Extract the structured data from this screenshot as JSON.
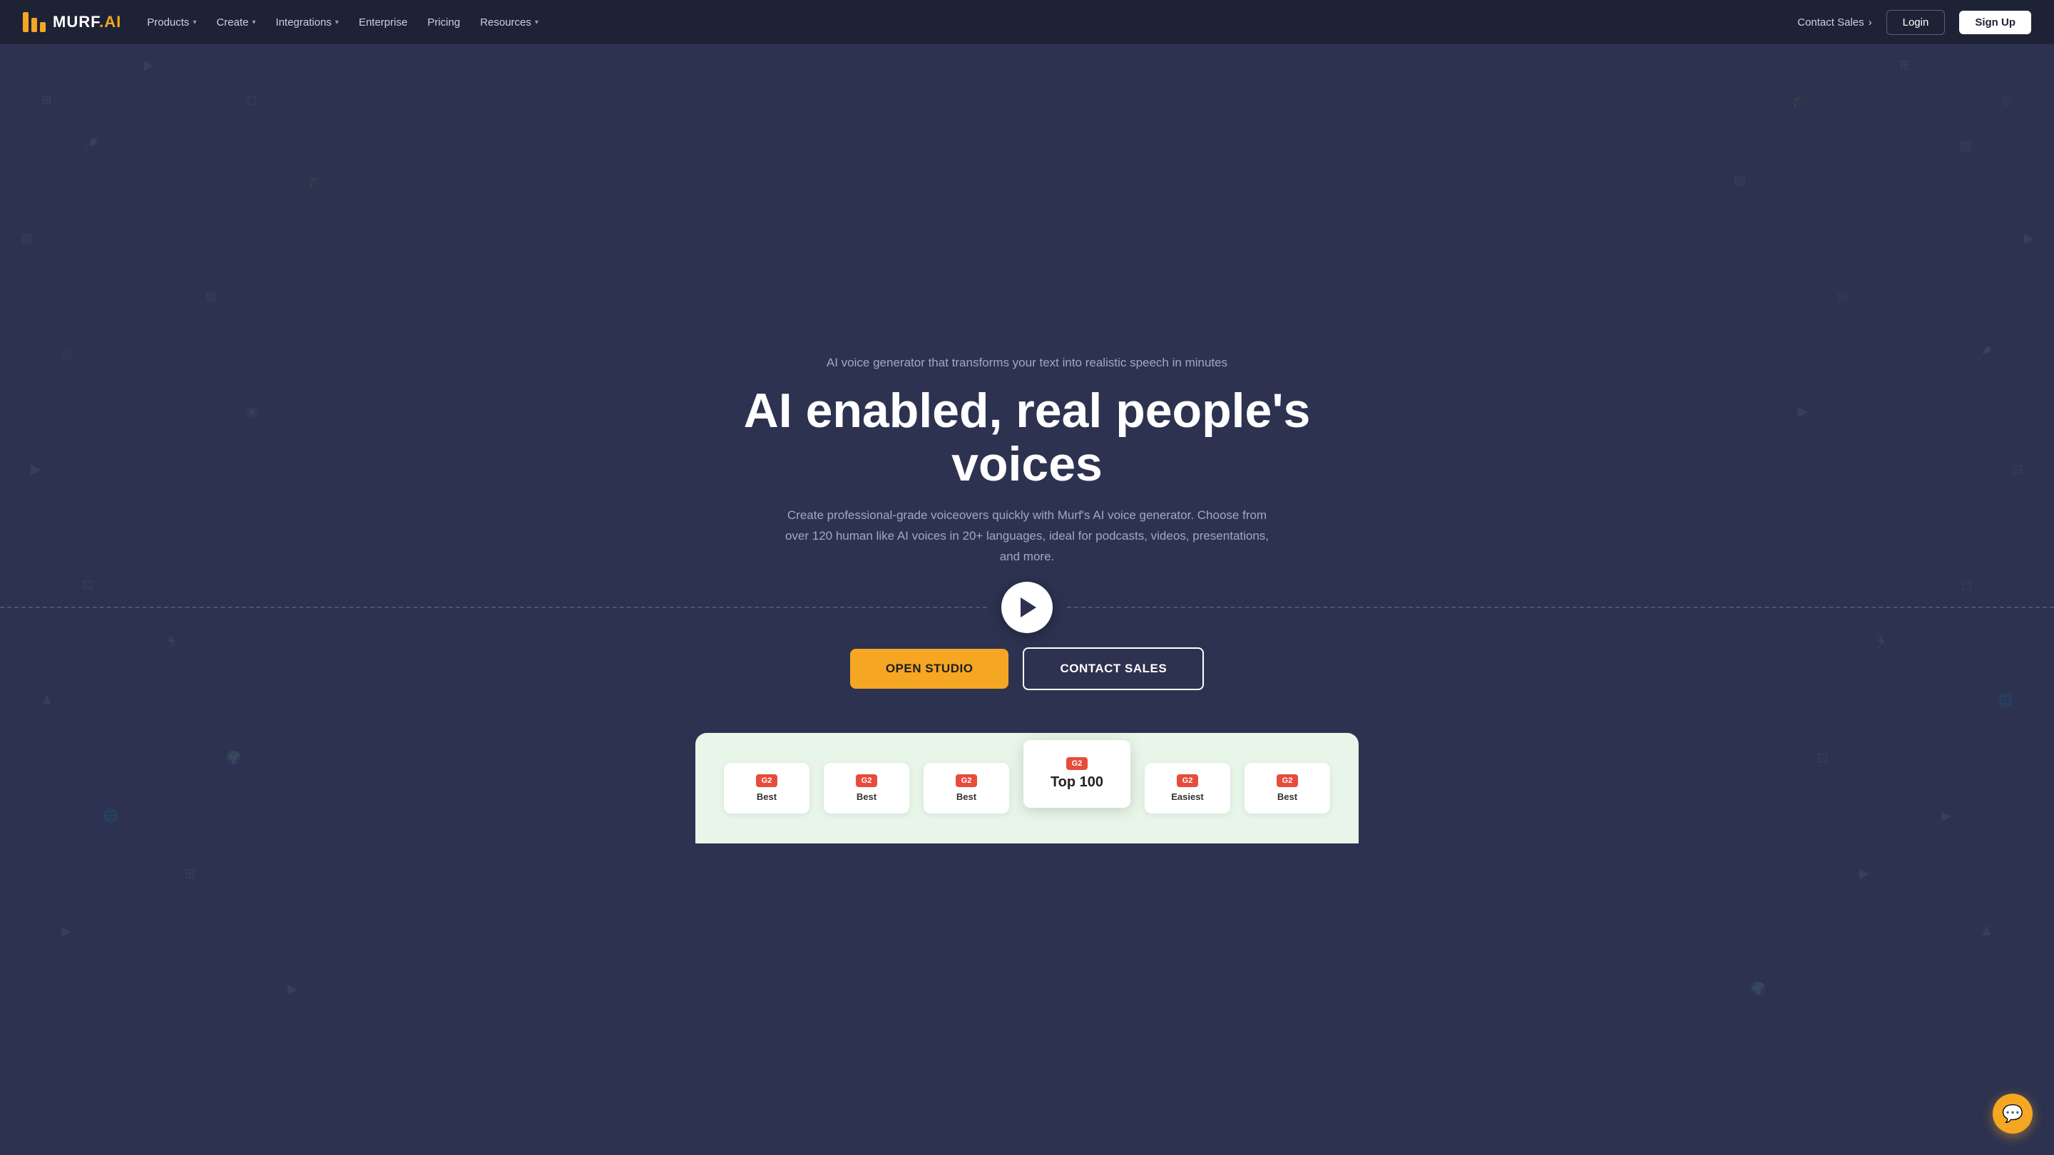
{
  "navbar": {
    "logo_text": "MURF",
    "logo_ai": ".AI",
    "nav_items": [
      {
        "label": "Products",
        "has_dropdown": true
      },
      {
        "label": "Create",
        "has_dropdown": true
      },
      {
        "label": "Integrations",
        "has_dropdown": true
      },
      {
        "label": "Enterprise",
        "has_dropdown": false
      },
      {
        "label": "Pricing",
        "has_dropdown": false
      },
      {
        "label": "Resources",
        "has_dropdown": true
      }
    ],
    "contact_sales_label": "Contact Sales",
    "login_label": "Login",
    "signup_label": "Sign Up"
  },
  "hero": {
    "subtitle": "AI voice generator that transforms your text into realistic speech in minutes",
    "title": "AI enabled, real people's voices",
    "description": "Create professional-grade voiceovers quickly with Murf's AI voice generator. Choose from over 120 human like AI voices in 20+ languages, ideal for podcasts, videos, presentations, and more.",
    "open_studio_label": "OPEN STUDIO",
    "contact_sales_label": "CONTACT SALES"
  },
  "awards": [
    {
      "g2_label": "G2",
      "award_line1": "Best",
      "featured": false
    },
    {
      "g2_label": "G2",
      "award_line1": "Best",
      "featured": false
    },
    {
      "g2_label": "G2",
      "award_line1": "Best",
      "featured": false
    },
    {
      "g2_label": "G2",
      "award_line1": "Top 100",
      "featured": true
    },
    {
      "g2_label": "G2",
      "award_line1": "Easiest",
      "featured": false
    },
    {
      "g2_label": "G2",
      "award_line1": "Best",
      "featured": false
    }
  ],
  "chat_icon": "💬"
}
